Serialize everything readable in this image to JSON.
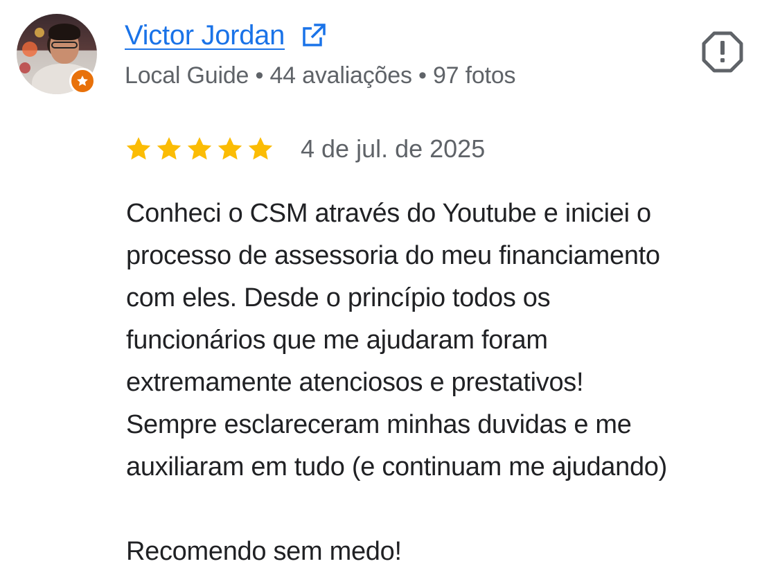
{
  "reviewer": {
    "name": "Victor Jordan",
    "meta": "Local Guide • 44 avaliações • 97 fotos",
    "badge_color": "#e8710a"
  },
  "icons": {
    "external_link": "external-link-icon",
    "report": "report-octagon-icon",
    "star": "star-icon",
    "guide_badge": "local-guide-star-icon"
  },
  "rating": {
    "stars": 5,
    "max": 5,
    "star_color": "#fbbc04"
  },
  "review": {
    "date": "4 de jul. de 2025",
    "text": "Conheci o CSM através do Youtube e iniciei o\nprocesso de assessoria do meu financiamento\ncom eles. Desde o princípio todos os\nfuncionários que me ajudaram foram\nextremamente atenciosos e prestativos!\nSempre esclareceram minhas duvidas e me\nauxiliaram em tudo (e continuam me ajudando)\n\nRecomendo sem medo!"
  },
  "colors": {
    "link": "#1a73e8",
    "secondary_text": "#5f6368",
    "primary_text": "#202124",
    "icon_gray": "#5f6368"
  }
}
